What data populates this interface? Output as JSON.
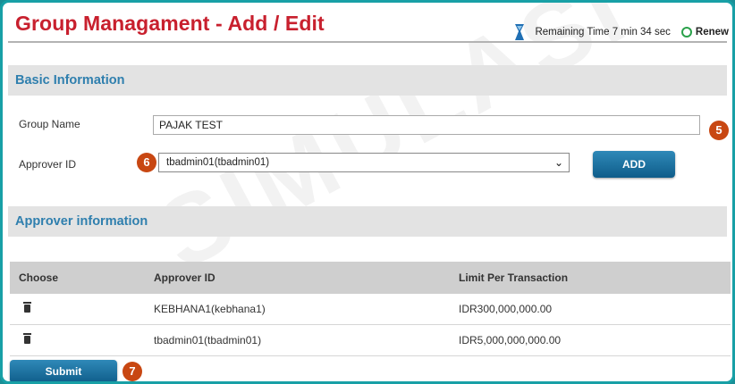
{
  "header": {
    "title": "Group Managament - Add / Edit",
    "remaining_time": "Remaining Time 7  min 34  sec",
    "renew_label": "Renew"
  },
  "basic_info": {
    "section_title": "Basic Information",
    "group_name_label": "Group Name",
    "group_name_value": "PAJAK TEST",
    "approver_id_label": "Approver ID",
    "approver_id_selected": "tbadmin01(tbadmin01)",
    "add_button": "ADD"
  },
  "approver_info": {
    "section_title": "Approver information",
    "columns": [
      "Choose",
      "Approver ID",
      "Limit Per Transaction"
    ],
    "rows": [
      {
        "approver_id": "KEBHANA1(kebhana1)",
        "limit": "IDR300,000,000.00"
      },
      {
        "approver_id": "tbadmin01(tbadmin01)",
        "limit": "IDR5,000,000,000.00"
      }
    ]
  },
  "submit_button": "Submit",
  "badges": {
    "b5": "5",
    "b6": "6",
    "b7": "7"
  },
  "watermark": "SIMULASI",
  "colors": {
    "title": "#c8202e",
    "section_text": "#2f7fae",
    "badge": "#c84712",
    "button": "#1a6fa0",
    "frame": "#18a0a6"
  }
}
